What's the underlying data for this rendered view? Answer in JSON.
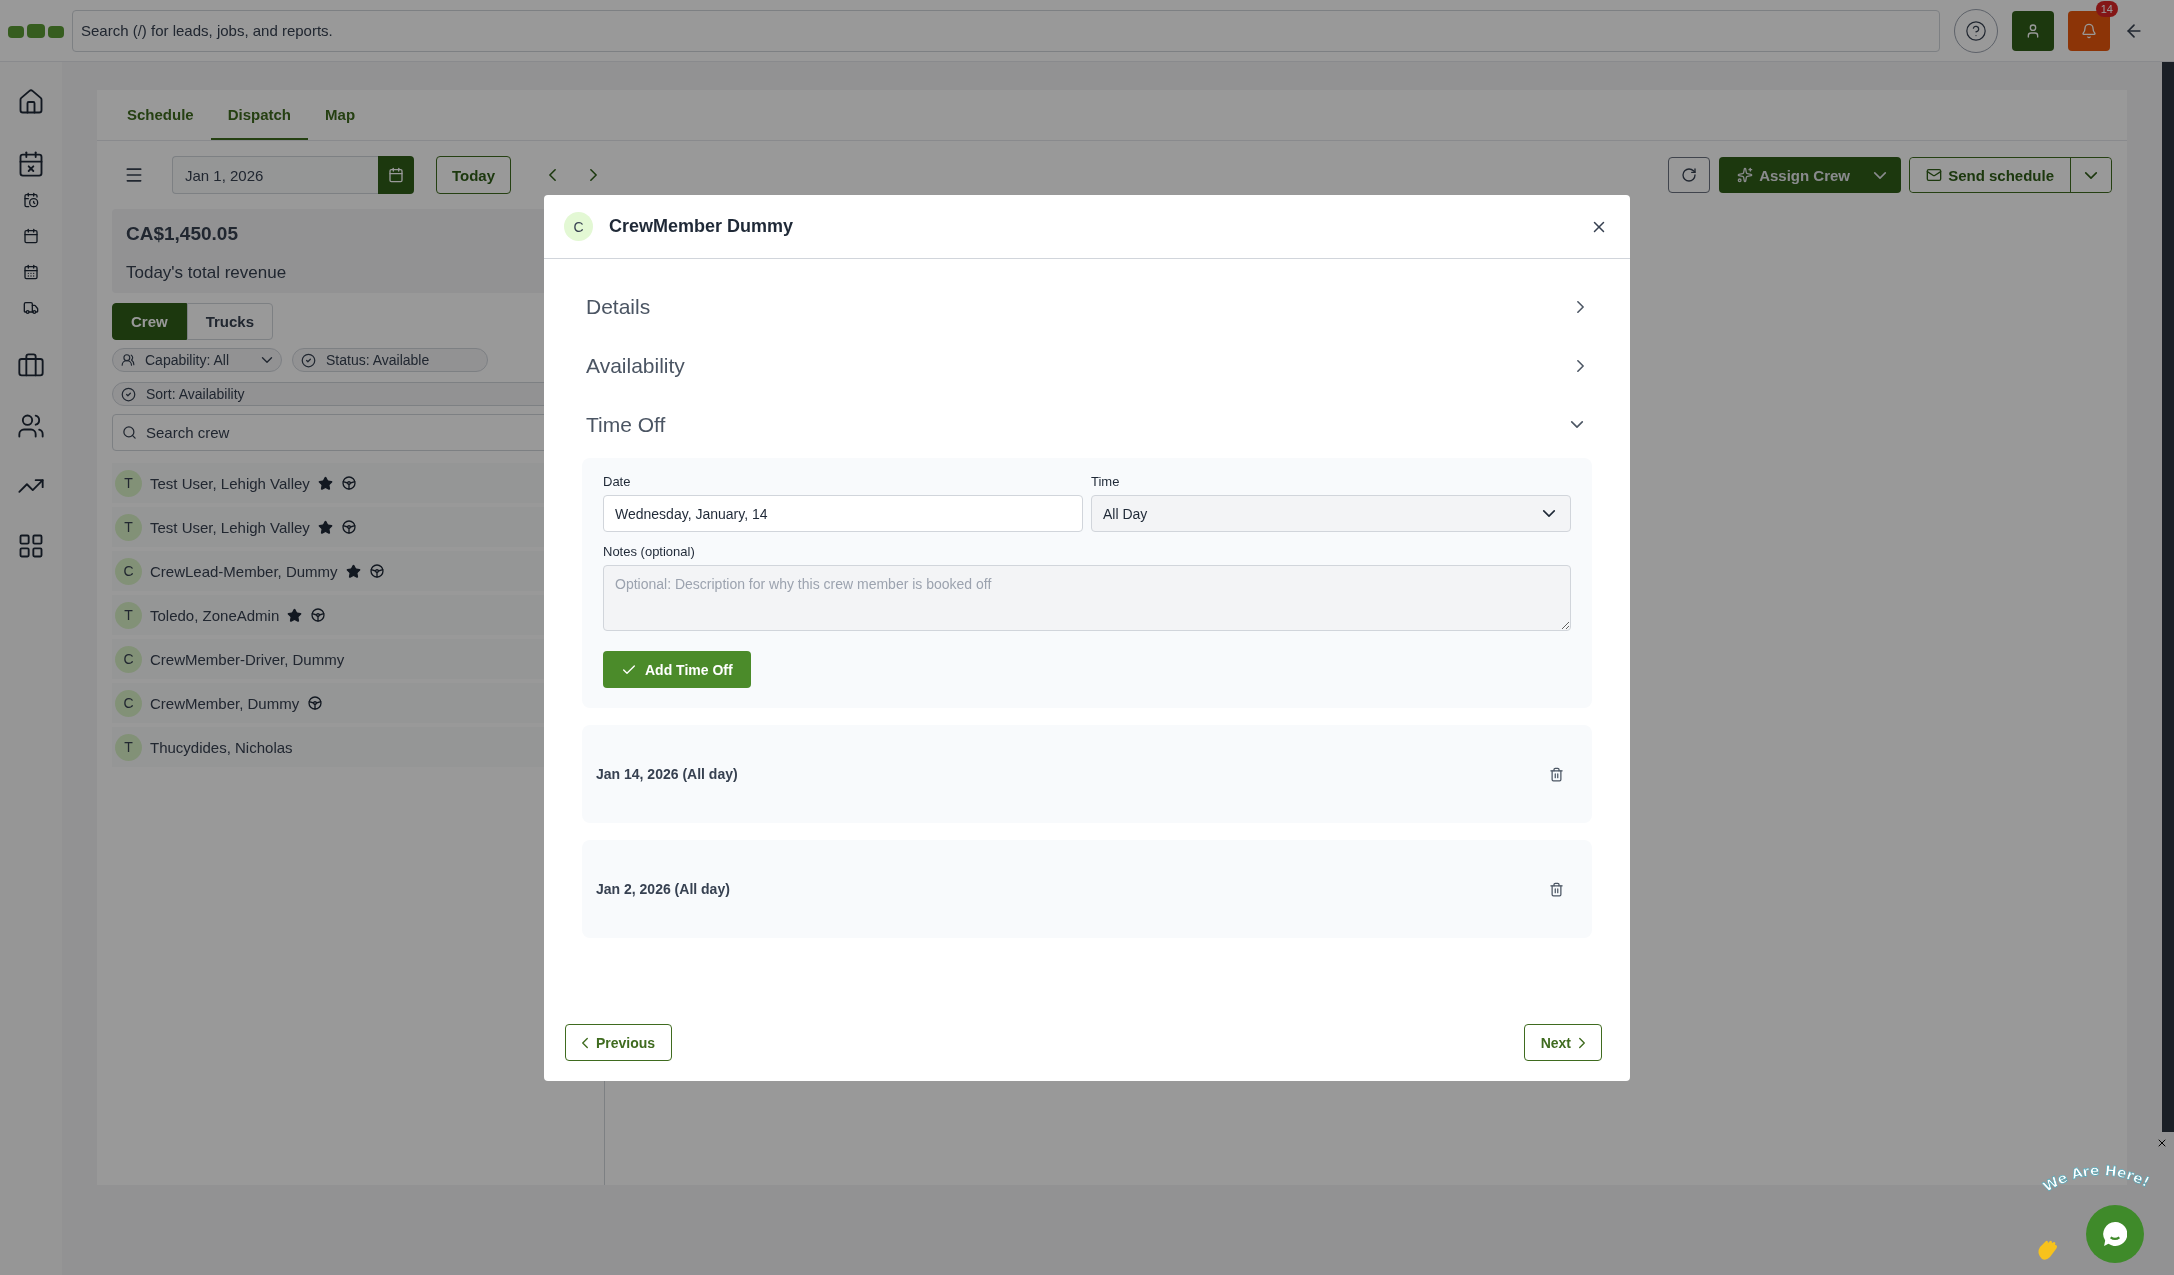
{
  "top_bar": {
    "search_placeholder": "Search (/) for leads, jobs, and reports.",
    "notification_count": "14"
  },
  "tabs": [
    {
      "label": "Schedule",
      "selected": false
    },
    {
      "label": "Dispatch",
      "selected": true
    },
    {
      "label": "Map",
      "selected": false
    }
  ],
  "toolbar": {
    "date": "Jan 1, 2026",
    "today": "Today",
    "assign": "Assign Crew",
    "send": "Send schedule"
  },
  "revenue": {
    "amount": "CA$1,450.05",
    "label": "Today's total revenue"
  },
  "resource_toggle": [
    {
      "label": "Crew",
      "selected": true
    },
    {
      "label": "Trucks",
      "selected": false
    }
  ],
  "filters": [
    {
      "label": "Capability: All",
      "kind": "capability"
    },
    {
      "label": "Status: Available",
      "kind": "status"
    },
    {
      "label": "Sort: Availability",
      "kind": "sort"
    }
  ],
  "crew_search": {
    "placeholder": "Search crew"
  },
  "crew": [
    {
      "initial": "T",
      "name": "Test User, Lehigh Valley",
      "lead": true,
      "driver": true
    },
    {
      "initial": "T",
      "name": "Test User, Lehigh Valley",
      "lead": true,
      "driver": true
    },
    {
      "initial": "C",
      "name": "CrewLead-Member, Dummy",
      "lead": true,
      "driver": true
    },
    {
      "initial": "T",
      "name": "Toledo, ZoneAdmin",
      "lead": true,
      "driver": true
    },
    {
      "initial": "C",
      "name": "CrewMember-Driver, Dummy",
      "lead": false,
      "driver": false
    },
    {
      "initial": "C",
      "name": "CrewMember, Dummy",
      "lead": false,
      "driver": true
    },
    {
      "initial": "T",
      "name": "Thucydides, Nicholas",
      "lead": false,
      "driver": false
    }
  ],
  "modal": {
    "avatar": "C",
    "title": "CrewMember Dummy",
    "sections": [
      {
        "title": "Details",
        "expanded": false
      },
      {
        "title": "Availability",
        "expanded": false
      },
      {
        "title": "Time Off",
        "expanded": true
      }
    ],
    "time_off_form": {
      "date_label": "Date",
      "date_value": "Wednesday, January, 14",
      "time_label": "Time",
      "time_value": "All Day",
      "notes_label": "Notes (optional)",
      "notes_placeholder": "Optional: Description for why this crew member is booked off",
      "add_button": "Add Time Off"
    },
    "entries": [
      {
        "label": "Jan 14, 2026 (All day)"
      },
      {
        "label": "Jan 2, 2026 (All day)"
      }
    ],
    "previous": "Previous",
    "next": "Next"
  },
  "chat_widget": {
    "text": "We Are Here!"
  }
}
